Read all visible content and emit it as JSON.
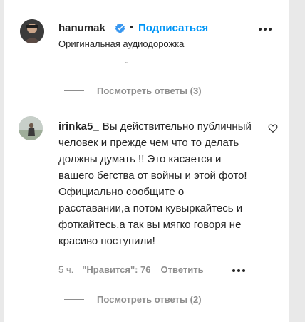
{
  "header": {
    "username": "hanumak",
    "separator": "•",
    "follow_label": "Подписаться",
    "subtitle": "Оригинальная аудиодорожка"
  },
  "replies_top": {
    "label": "Посмотреть ответы (3)"
  },
  "comment": {
    "username": "irinka5_",
    "text": "Вы действительно публичный человек и прежде чем что то делать должны думать !! Это касается и вашего бегства от войны и этой фото! Официально сообщите о расставании,а потом кувыркайтесь и фоткайтесь,а так вы мягко говоря не красиво поступили!",
    "time": "5 ч.",
    "likes": "\"Нравится\": 76",
    "reply_label": "Ответить"
  },
  "replies_bottom": {
    "label": "Посмотреть ответы (2)"
  },
  "colors": {
    "accent": "#0095f6",
    "muted": "#8e8e8e",
    "text": "#262626"
  },
  "icons": [
    "verified-icon",
    "more-options-icon",
    "heart-icon"
  ]
}
